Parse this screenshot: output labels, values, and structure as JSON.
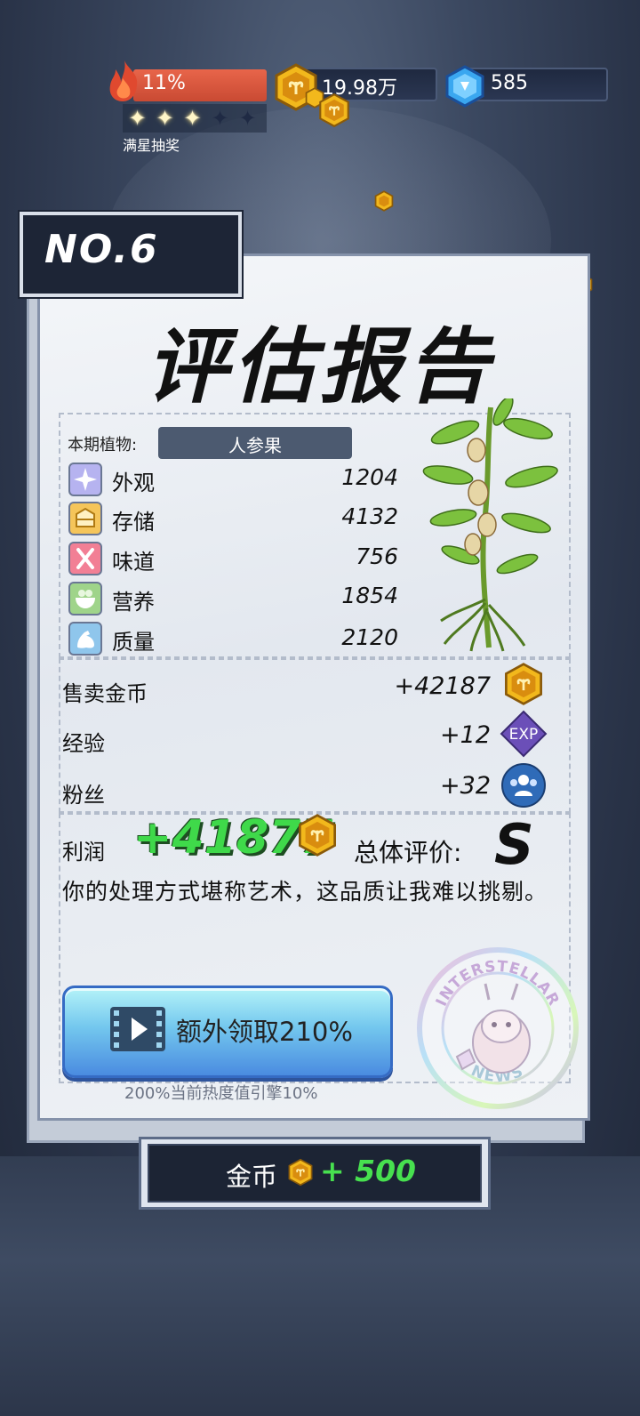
{
  "hud": {
    "heat_percent": "11%",
    "heat_level": 0.11,
    "stars_filled": 3,
    "stars_total": 5,
    "star_label": "满星抽奖",
    "coins": "19.98万",
    "gems": "585"
  },
  "report": {
    "number": "NO.6",
    "title": "评估报告",
    "plant_label": "本期植物:",
    "plant_name": "人参果",
    "attributes": [
      {
        "name": "外观",
        "value": "1204",
        "icon": "sparkle-icon"
      },
      {
        "name": "存储",
        "value": "4132",
        "icon": "box-icon"
      },
      {
        "name": "味道",
        "value": "756",
        "icon": "utensils-icon"
      },
      {
        "name": "营养",
        "value": "1854",
        "icon": "bowl-icon"
      },
      {
        "name": "质量",
        "value": "2120",
        "icon": "muscle-icon"
      }
    ],
    "rewards": [
      {
        "label": "售卖金币",
        "value": "+42187",
        "icon": "coin-icon"
      },
      {
        "label": "经验",
        "value": "+12",
        "icon": "exp-icon"
      },
      {
        "label": "粉丝",
        "value": "+32",
        "icon": "fans-icon"
      }
    ],
    "profit_label": "利润",
    "profit_value": "+41877",
    "rating_label": "总体评价:",
    "rating_value": "S",
    "comment": "你的处理方式堪称艺术，这品质让我难以挑剔。",
    "claim_button": "额外领取210%",
    "claim_note": "200%当前热度值引擎10%",
    "stamp_top": "INTERSTELLAR",
    "stamp_bottom": "NEWS"
  },
  "bottom_button": {
    "label": "金币",
    "amount": "+ 500"
  },
  "colors": {
    "profit_green": "#3fd94a",
    "heat_red": "#d9553c",
    "coin_gold": "#f2b81c",
    "exp_purple": "#6b4fb8",
    "fans_blue": "#2f6bb8"
  }
}
